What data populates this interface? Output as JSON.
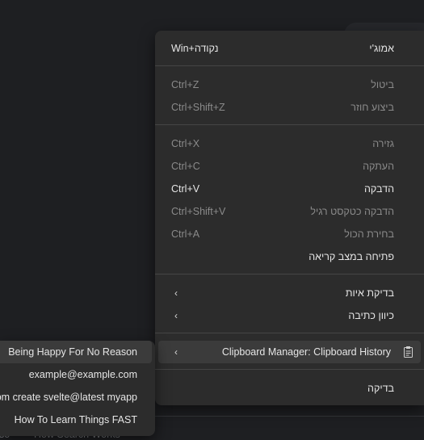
{
  "background": {
    "bottom_text_left": "so",
    "bottom_text_right": "How Search Works"
  },
  "context_menu": {
    "sections": [
      [
        {
          "label": "אמוג'י",
          "shortcut": "Win+נקודה",
          "state": "enabled"
        }
      ],
      [
        {
          "label": "ביטול",
          "shortcut": "Ctrl+Z",
          "state": "disabled"
        },
        {
          "label": "ביצוע חוזר",
          "shortcut": "Ctrl+Shift+Z",
          "state": "disabled"
        }
      ],
      [
        {
          "label": "גזירה",
          "shortcut": "Ctrl+X",
          "state": "disabled"
        },
        {
          "label": "העתקה",
          "shortcut": "Ctrl+C",
          "state": "disabled"
        },
        {
          "label": "הדבקה",
          "shortcut": "Ctrl+V",
          "state": "enabled"
        },
        {
          "label": "הדבקה כטקסט רגיל",
          "shortcut": "Ctrl+Shift+V",
          "state": "disabled"
        },
        {
          "label": "בחירת הכול",
          "shortcut": "Ctrl+A",
          "state": "disabled"
        },
        {
          "label": "פתיחה במצב קריאה",
          "shortcut": "",
          "state": "enabled"
        }
      ],
      [
        {
          "label": "בדיקת איות",
          "submenu": true,
          "icon": "chevron-left-icon"
        },
        {
          "label": "כיוון כתיבה",
          "submenu": true,
          "icon": "chevron-left-icon"
        }
      ],
      [
        {
          "label": "Clipboard Manager: Clipboard History",
          "submenu": true,
          "icon": "clipboard-icon",
          "highlighted": true
        }
      ],
      [
        {
          "label": "בדיקה",
          "state": "enabled"
        }
      ]
    ]
  },
  "clipboard_submenu": {
    "items": [
      {
        "text": "Being Happy For No Reason",
        "selected": true
      },
      {
        "text": "example@example.com"
      },
      {
        "text": "pnpm create svelte@latest myapp"
      },
      {
        "text": "How To Learn Things FAST"
      }
    ]
  }
}
